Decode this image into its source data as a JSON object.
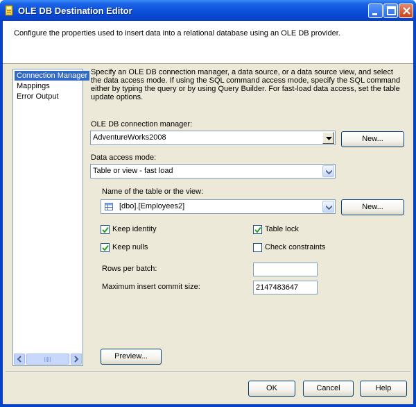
{
  "window": {
    "title": "OLE DB Destination Editor"
  },
  "header": {
    "text": "Configure the properties used to insert data into a relational database using an OLE DB provider."
  },
  "sidebar": {
    "items": [
      {
        "label": "Connection Manager",
        "selected": true
      },
      {
        "label": "Mappings",
        "selected": false
      },
      {
        "label": "Error Output",
        "selected": false
      }
    ]
  },
  "main": {
    "description": "Specify an OLE DB connection manager, a data source, or a data source view, and select the data access mode. If using the SQL command access mode, specify the SQL command either by typing the query or by using Query Builder. For fast-load data access, set the table update options.",
    "connection_label": "OLE DB connection manager:",
    "connection_value": "AdventureWorks2008",
    "new_label": "New...",
    "access_label": "Data access mode:",
    "access_value": "Table or view - fast load",
    "table_label": "Name of the table or the view:",
    "table_value": "[dbo].[Employees2]",
    "options": {
      "keep_identity": {
        "label": "Keep identity",
        "checked": true
      },
      "table_lock": {
        "label": "Table lock",
        "checked": true
      },
      "keep_nulls": {
        "label": "Keep nulls",
        "checked": true
      },
      "check_constraints": {
        "label": "Check constraints",
        "checked": false
      }
    },
    "rows_per_batch_label": "Rows per batch:",
    "rows_per_batch_value": "",
    "max_commit_label": "Maximum insert commit size:",
    "max_commit_value": "2147483647",
    "preview_label": "Preview..."
  },
  "footer": {
    "ok": "OK",
    "cancel": "Cancel",
    "help": "Help"
  },
  "colors": {
    "titlebar": "#0a4fd9",
    "selection": "#316ac5",
    "face": "#ece9d8",
    "border": "#7f9db9"
  }
}
